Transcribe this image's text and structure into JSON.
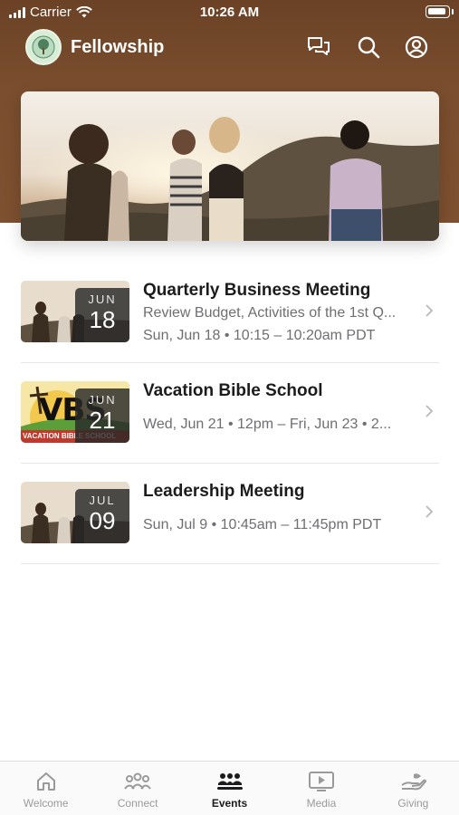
{
  "status_bar": {
    "carrier": "Carrier",
    "time": "10:26 AM"
  },
  "nav": {
    "app_title": "Fellowship",
    "icons": [
      "chat-icon",
      "search-icon",
      "profile-icon"
    ]
  },
  "events": [
    {
      "month": "JUN",
      "day": "18",
      "title": "Quarterly Business Meeting",
      "line1": "Review Budget, Activities of the 1st Q...",
      "line2": "Sun, Jun 18 • 10:15 – 10:20am PDT"
    },
    {
      "month": "JUN",
      "day": "21",
      "title": "Vacation Bible School",
      "line1": "Wed, Jun 21 • 12pm – Fri, Jun 23 • 2...",
      "thumb_text": "VBS",
      "thumb_banner": "VACATION BIBLE SCHOOL"
    },
    {
      "month": "JUL",
      "day": "09",
      "title": "Leadership Meeting",
      "line1": "Sun, Jul 9 • 10:45am – 11:45pm PDT"
    }
  ],
  "tabs": [
    {
      "label": "Welcome",
      "icon": "home-icon",
      "active": false
    },
    {
      "label": "Connect",
      "icon": "people-icon",
      "active": false
    },
    {
      "label": "Events",
      "icon": "events-icon",
      "active": true
    },
    {
      "label": "Media",
      "icon": "media-icon",
      "active": false
    },
    {
      "label": "Giving",
      "icon": "giving-icon",
      "active": false
    }
  ],
  "colors": {
    "header": "#7a4e2e",
    "text_primary": "#1c1c1e",
    "text_secondary": "#6e6e73",
    "tab_inactive": "#9a9a9a"
  }
}
